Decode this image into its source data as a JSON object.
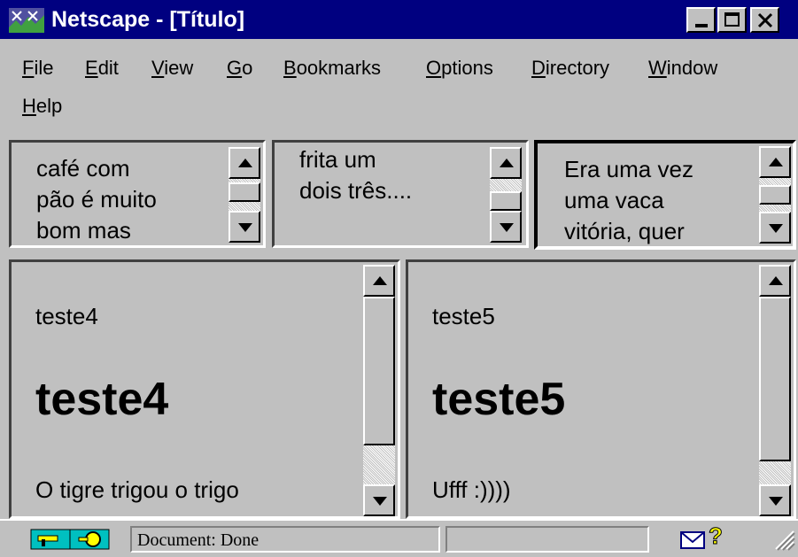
{
  "window": {
    "title": "Netscape - [Título]",
    "icon": "netscape-logo-icon"
  },
  "menu": {
    "file": {
      "ul": "F",
      "rest": "ile"
    },
    "edit": {
      "ul": "E",
      "rest": "dit"
    },
    "view": {
      "ul": "V",
      "rest": "iew"
    },
    "go": {
      "ul": "G",
      "rest": "o"
    },
    "bookmarks": {
      "ul": "B",
      "rest": "ookmarks"
    },
    "options": {
      "ul": "O",
      "rest": "ptions"
    },
    "directory": {
      "ul": "D",
      "rest": "irectory"
    },
    "window": {
      "ul": "W",
      "rest": "indow"
    },
    "help": {
      "ul": "H",
      "rest": "elp"
    }
  },
  "frames": {
    "top1": {
      "lines": [
        "café com",
        "pão é muito",
        "bom mas"
      ]
    },
    "top2": {
      "lines": [
        "frita um",
        "dois três...."
      ]
    },
    "top3": {
      "lines": [
        "Era uma vez",
        "uma vaca",
        "vitória, quer"
      ]
    },
    "left": {
      "small": "teste4",
      "big": "teste4",
      "bottom": "O tigre trigou o trigo"
    },
    "right": {
      "small": "teste5",
      "big": "teste5",
      "bottom": "Ufff :))))"
    }
  },
  "status": {
    "text": "Document: Done",
    "icons": [
      "security-key-icon",
      "mail-icon",
      "help-question-icon"
    ],
    "colors": {
      "key": "#ffff00",
      "mail": "#000080",
      "question": "#ffff00"
    }
  }
}
